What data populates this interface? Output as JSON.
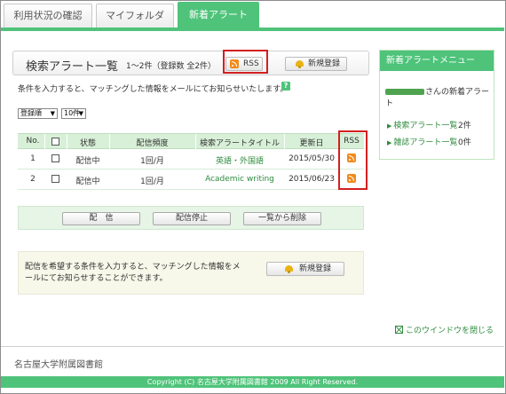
{
  "tabs": [
    {
      "label": "利用状況の確認"
    },
    {
      "label": "マイフォルダ"
    },
    {
      "label": "新着アラート"
    }
  ],
  "panel": {
    "title": "検索アラート一覧",
    "count": "1～2件（登録数 全2件）",
    "rss_label": "RSS",
    "new_label": "新規登録",
    "description": "条件を入力すると、マッチングした情報をメールにてお知らせいたします。",
    "help": "?"
  },
  "selects": {
    "sort": "登録順",
    "per_page": "10件"
  },
  "table": {
    "headers": {
      "no": "No.",
      "status": "状態",
      "frequency": "配信頻度",
      "title": "検索アラートタイトル",
      "updated": "更新日",
      "rss": "RSS"
    },
    "rows": [
      {
        "no": "1",
        "status": "配信中",
        "frequency": "1回/月",
        "title": "英語・外国語",
        "updated": "2015/05/30"
      },
      {
        "no": "2",
        "status": "配信中",
        "frequency": "1回/月",
        "title": "Academic writing",
        "updated": "2015/06/23"
      }
    ]
  },
  "actions": {
    "deliver": "配　信",
    "stop": "配信停止",
    "delete": "一覧から削除"
  },
  "info": {
    "text": "配信を希望する条件を入力すると、マッチングした情報をメールにてお知らせすることができます。",
    "new_label": "新規登録"
  },
  "sidebar": {
    "header": "新着アラートメニュー",
    "user_suffix": "さんの新着アラート",
    "links": [
      {
        "label": "検索アラート一覧",
        "count": "2件"
      },
      {
        "label": "雑誌アラート一覧",
        "count": "0件"
      }
    ]
  },
  "close_window": "このウインドウを閉じる",
  "library_name": "名古屋大学附属図書館",
  "copyright": "Copyright (C) 名古屋大学附属図書館 2009 All Right Reserved.",
  "colors": {
    "accent": "#4fc37a",
    "link": "#2e8b3e",
    "highlight": "#d22020",
    "rss": "#f28a1b"
  }
}
